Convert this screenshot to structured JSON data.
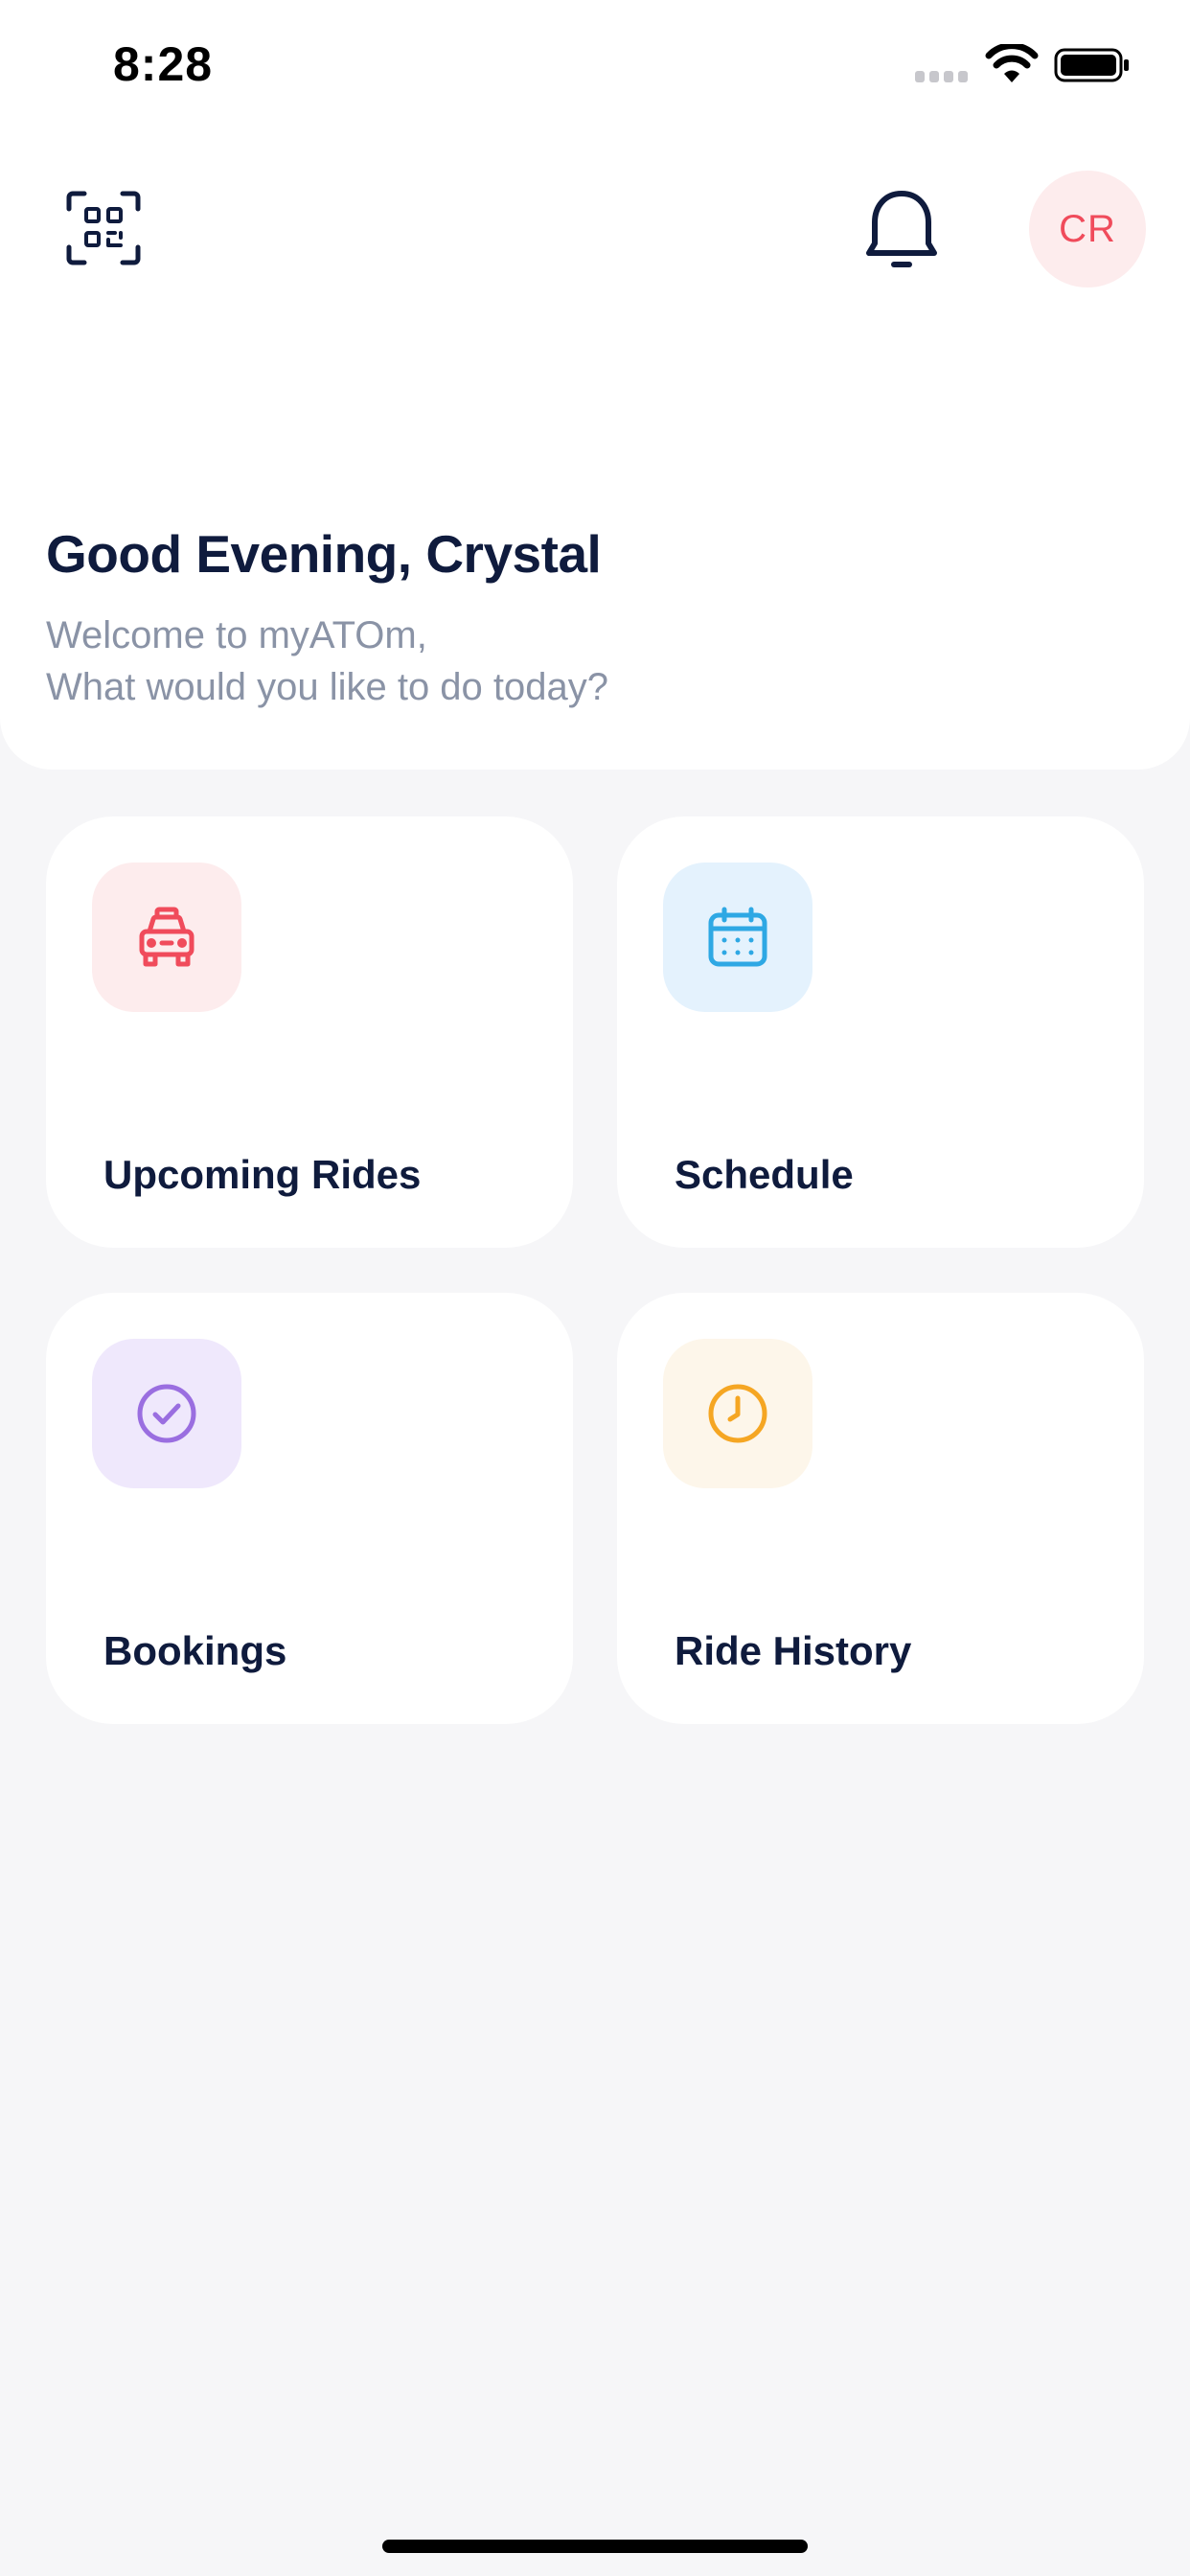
{
  "status_bar": {
    "time": "8:28"
  },
  "header": {
    "qr_icon": "qr-scan-icon",
    "bell_icon": "bell-icon",
    "avatar_initials": "CR",
    "avatar_color": "#f04b5b",
    "avatar_bg": "#fdeced"
  },
  "greeting": {
    "title": "Good Evening, Crystal",
    "subtitle_line1": "Welcome to myATOm,",
    "subtitle_line2": "What would you like to do today?"
  },
  "cards": [
    {
      "label": "Upcoming Rides",
      "icon": "taxi-icon",
      "icon_color": "#f04b5b",
      "icon_bg": "#fdeced"
    },
    {
      "label": "Schedule",
      "icon": "calendar-icon",
      "icon_color": "#2ea8e4",
      "icon_bg": "#e4f2fd"
    },
    {
      "label": "Bookings",
      "icon": "check-circle-icon",
      "icon_color": "#9a6ee0",
      "icon_bg": "#efe8fc"
    },
    {
      "label": "Ride History",
      "icon": "clock-icon",
      "icon_color": "#f5a623",
      "icon_bg": "#fdf6ea"
    }
  ]
}
